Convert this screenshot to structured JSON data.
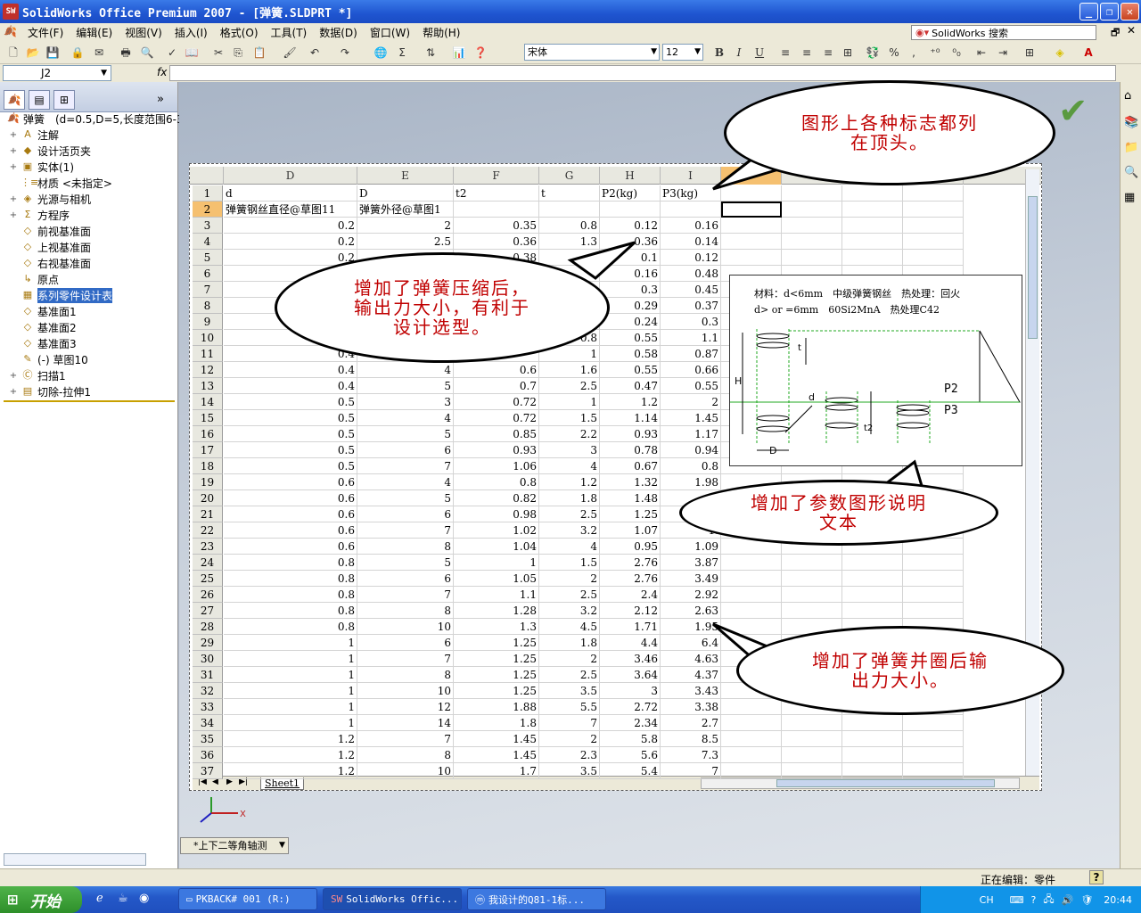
{
  "window": {
    "title": "SolidWorks Office Premium 2007 - [弹簧.SLDPRT *]",
    "app_icon": "SW"
  },
  "menu": {
    "items": [
      "文件(F)",
      "编辑(E)",
      "视图(V)",
      "插入(I)",
      "格式(O)",
      "工具(T)",
      "数据(D)",
      "窗口(W)",
      "帮助(H)"
    ],
    "search_label": "SolidWorks 搜索"
  },
  "toolbar": {
    "font": "宋体",
    "size": "12",
    "bold": "B",
    "italic": "I",
    "underline": "U",
    "percent": "%",
    "comma": ","
  },
  "formula": {
    "cell_ref": "J2",
    "fx": "fx",
    "value": ""
  },
  "tree": {
    "root": "弹簧　(d=0.5,D=5,长度范围6-3",
    "items": [
      {
        "label": "注解",
        "icon": "A",
        "expand": "+"
      },
      {
        "label": "设计活页夹",
        "icon": "◆",
        "expand": "+"
      },
      {
        "label": "实体(1)",
        "icon": "▣",
        "expand": "+"
      },
      {
        "label": "材质 <未指定>",
        "icon": "⋮≡",
        "expand": ""
      },
      {
        "label": "光源与相机",
        "icon": "◈",
        "expand": "+"
      },
      {
        "label": "方程序",
        "icon": "Σ",
        "expand": "+"
      },
      {
        "label": "前视基准面",
        "icon": "◇",
        "expand": ""
      },
      {
        "label": "上视基准面",
        "icon": "◇",
        "expand": ""
      },
      {
        "label": "右视基准面",
        "icon": "◇",
        "expand": ""
      },
      {
        "label": "原点",
        "icon": "↳",
        "expand": ""
      },
      {
        "label": "系列零件设计表",
        "icon": "▦",
        "expand": ""
      },
      {
        "label": "基准面1",
        "icon": "◇",
        "expand": ""
      },
      {
        "label": "基准面2",
        "icon": "◇",
        "expand": ""
      },
      {
        "label": "基准面3",
        "icon": "◇",
        "expand": ""
      },
      {
        "label": "(-) 草图10",
        "icon": "✎",
        "expand": ""
      },
      {
        "label": "扫描1",
        "icon": "Ⓒ",
        "expand": "+"
      },
      {
        "label": "切除-拉伸1",
        "icon": "▤",
        "expand": "+"
      }
    ]
  },
  "spreadsheet": {
    "columns": [
      "D",
      "E",
      "F",
      "G",
      "H",
      "I",
      "",
      "",
      "",
      "N"
    ],
    "header_row1": [
      "d",
      "D",
      "t2",
      "t",
      "P2(kg)",
      "P3(kg)"
    ],
    "header_row2": [
      "弹簧钢丝直径@草图11",
      "弹簧外径@草图1"
    ],
    "rows": [
      [
        "3",
        "0.2",
        "2",
        "0.35",
        "0.8",
        "0.12",
        "0.16"
      ],
      [
        "4",
        "0.2",
        "2.5",
        "0.36",
        "1.3",
        "0.36",
        "0.14"
      ],
      [
        "5",
        "0.2",
        "",
        "0.38",
        "",
        "0.1",
        "0.12"
      ],
      [
        "6",
        "0.3",
        "",
        "",
        "",
        "0.16",
        "0.48"
      ],
      [
        "7",
        "",
        "",
        "",
        "",
        "0.3",
        "0.45"
      ],
      [
        "8",
        "",
        "",
        "",
        "",
        "0.29",
        "0.37"
      ],
      [
        "9",
        "",
        "",
        "",
        "",
        "0.24",
        "0.3"
      ],
      [
        "10",
        "",
        "",
        "",
        "0.8",
        "0.55",
        "1.1"
      ],
      [
        "11",
        "0.4",
        "",
        "",
        "1",
        "0.58",
        "0.87"
      ],
      [
        "12",
        "0.4",
        "4",
        "0.6",
        "1.6",
        "0.55",
        "0.66"
      ],
      [
        "13",
        "0.4",
        "5",
        "0.7",
        "2.5",
        "0.47",
        "0.55"
      ],
      [
        "14",
        "0.5",
        "3",
        "0.72",
        "1",
        "1.2",
        "2"
      ],
      [
        "15",
        "0.5",
        "4",
        "0.72",
        "1.5",
        "1.14",
        "1.45"
      ],
      [
        "16",
        "0.5",
        "5",
        "0.85",
        "2.2",
        "0.93",
        "1.17"
      ],
      [
        "17",
        "0.5",
        "6",
        "0.93",
        "3",
        "0.78",
        "0.94"
      ],
      [
        "18",
        "0.5",
        "7",
        "1.06",
        "4",
        "0.67",
        "0.8"
      ],
      [
        "19",
        "0.6",
        "4",
        "0.8",
        "1.2",
        "1.32",
        "1.98"
      ],
      [
        "20",
        "0.6",
        "5",
        "0.82",
        "1.8",
        "1.48",
        ""
      ],
      [
        "21",
        "0.6",
        "6",
        "0.98",
        "2.5",
        "1.25",
        ""
      ],
      [
        "22",
        "0.6",
        "7",
        "1.02",
        "3.2",
        "1.07",
        "1."
      ],
      [
        "23",
        "0.6",
        "8",
        "1.04",
        "4",
        "0.95",
        "1.09"
      ],
      [
        "24",
        "0.8",
        "5",
        "1",
        "1.5",
        "2.76",
        "3.87"
      ],
      [
        "25",
        "0.8",
        "6",
        "1.05",
        "2",
        "2.76",
        "3.49"
      ],
      [
        "26",
        "0.8",
        "7",
        "1.1",
        "2.5",
        "2.4",
        "2.92"
      ],
      [
        "27",
        "0.8",
        "8",
        "1.28",
        "3.2",
        "2.12",
        "2.63"
      ],
      [
        "28",
        "0.8",
        "10",
        "1.3",
        "4.5",
        "1.71",
        "1.95"
      ],
      [
        "29",
        "1",
        "6",
        "1.25",
        "1.8",
        "4.4",
        "6.4"
      ],
      [
        "30",
        "1",
        "7",
        "1.25",
        "2",
        "3.46",
        "4.63"
      ],
      [
        "31",
        "1",
        "8",
        "1.25",
        "2.5",
        "3.64",
        "4.37"
      ],
      [
        "32",
        "1",
        "10",
        "1.25",
        "3.5",
        "3",
        "3.43"
      ],
      [
        "33",
        "1",
        "12",
        "1.88",
        "5.5",
        "2.72",
        "3.38"
      ],
      [
        "34",
        "1",
        "14",
        "1.8",
        "7",
        "2.34",
        "2.7"
      ],
      [
        "35",
        "1.2",
        "7",
        "1.45",
        "2",
        "5.8",
        "8.5"
      ],
      [
        "36",
        "1.2",
        "8",
        "1.45",
        "2.3",
        "5.6",
        "7.3"
      ],
      [
        "37",
        "1.2",
        "10",
        "1.7",
        "3.5",
        "5.4",
        "7"
      ]
    ],
    "sheet_tab": "Sheet1"
  },
  "callouts": {
    "top": "图形上各种标志都列\n在顶头。",
    "left": "增加了弹簧压缩后，\n输出力大小，有利于\n设计选型。",
    "mid": "增加了参数图形说明\n文本",
    "bottom": "增加了弹簧并圈后输\n出力大小。"
  },
  "diagram": {
    "line1": "材料：d<6mm　中级弹簧钢丝　热处理：回火",
    "line2": "d> or =6mm　60Si2MnA　热处理C42",
    "labels": {
      "H": "H",
      "t": "t",
      "d": "d",
      "D": "D",
      "t2": "t2",
      "P2": "P2",
      "P3": "P3"
    }
  },
  "view": {
    "orientation": "*上下二等角轴测"
  },
  "status": {
    "editing": "正在编辑：零件",
    "help": "?"
  },
  "taskbar": {
    "start": "开始",
    "items": [
      "PKBACK# 001 (R:)",
      "SolidWorks Offic...",
      "我设计的Q81-1标..."
    ],
    "lang": "CH",
    "clock": "20:44"
  }
}
